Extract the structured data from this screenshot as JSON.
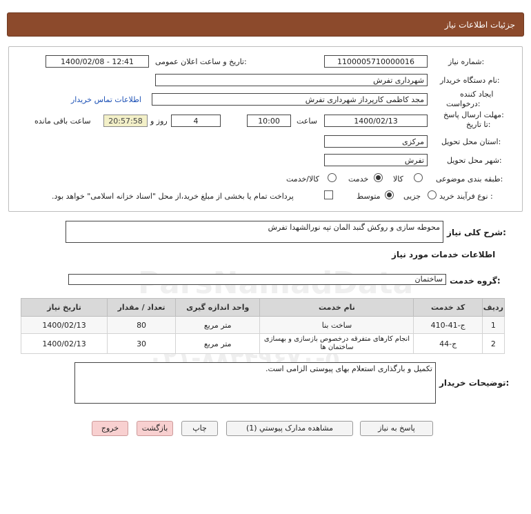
{
  "header": {
    "title": "جزئیات اطلاعات نیاز"
  },
  "form": {
    "need_number_label": "شماره نیاز:",
    "need_number": "1100005710000016",
    "announce_label": "تاریخ و ساعت اعلان عمومی:",
    "announce_value": "1400/02/08 - 12:41",
    "buyer_org_label": "نام دستگاه خریدار:",
    "buyer_org": "شهرداری تفرش",
    "creator_label_1": "ایجاد کننده",
    "creator_label_2": "درخواست:",
    "creator": "مجد کاظمی کارپرداز شهرداری تفرش",
    "contact_link": "اطلاعات تماس خریدار",
    "deadline_label_1": "مهلت ارسال پاسخ:",
    "deadline_label_2": "تا تاریخ:",
    "deadline_date": "1400/02/13",
    "time_label": "ساعت",
    "deadline_time": "10:00",
    "days": "4",
    "days_label": "روز و",
    "remaining_time": "20:57:58",
    "remaining_label": "ساعت باقی مانده",
    "province_label": "استان محل تحویل:",
    "province": "مرکزی",
    "city_label": "شهر محل تحویل:",
    "city": "تفرش",
    "category_label": "طبقه بندی موضوعی:",
    "category_options": [
      "کالا",
      "خدمت",
      "کالا/خدمت"
    ],
    "purchase_label": "نوع فرآیند خرید :",
    "purchase_options": [
      "جزیی",
      "متوسط"
    ],
    "payment_note": "پرداخت تمام یا بخشی از مبلغ خرید،از محل \"اسناد خزانه اسلامی\" خواهد بود."
  },
  "summary": {
    "label": "شرح کلی نیاز:",
    "value": "محوطه سازی و روکش گنبد المان تپه نورالشهدا تفرش"
  },
  "services": {
    "section_title": "اطلاعات خدمات مورد نیاز",
    "group_label": "گروه خدمت:",
    "group_value": "ساختمان",
    "columns": [
      "ردیف",
      "کد خدمت",
      "نام خدمت",
      "واحد اندازه گیری",
      "تعداد / مقدار",
      "تاریخ نیاز"
    ],
    "rows": [
      [
        "1",
        "ج-41-410",
        "ساخت بنا",
        "متر مربع",
        "80",
        "1400/02/13"
      ],
      [
        "2",
        "ج-44",
        "انجام کارهای متفرقه درخصوص بازسازی و بهسازی ساختمان ها",
        "متر مربع",
        "30",
        "1400/02/13"
      ]
    ]
  },
  "buyer_notes": {
    "label": "توضیحات خریدار:",
    "value": "تکمیل و بارگذاری استعلام بهای پیوستی الزامی است."
  },
  "buttons": {
    "reply": "پاسخ به نیاز",
    "attachments": "مشاهده مدارک پیوستي (1)",
    "print": "چاپ",
    "back": "بازگشت",
    "exit": "خروج"
  }
}
